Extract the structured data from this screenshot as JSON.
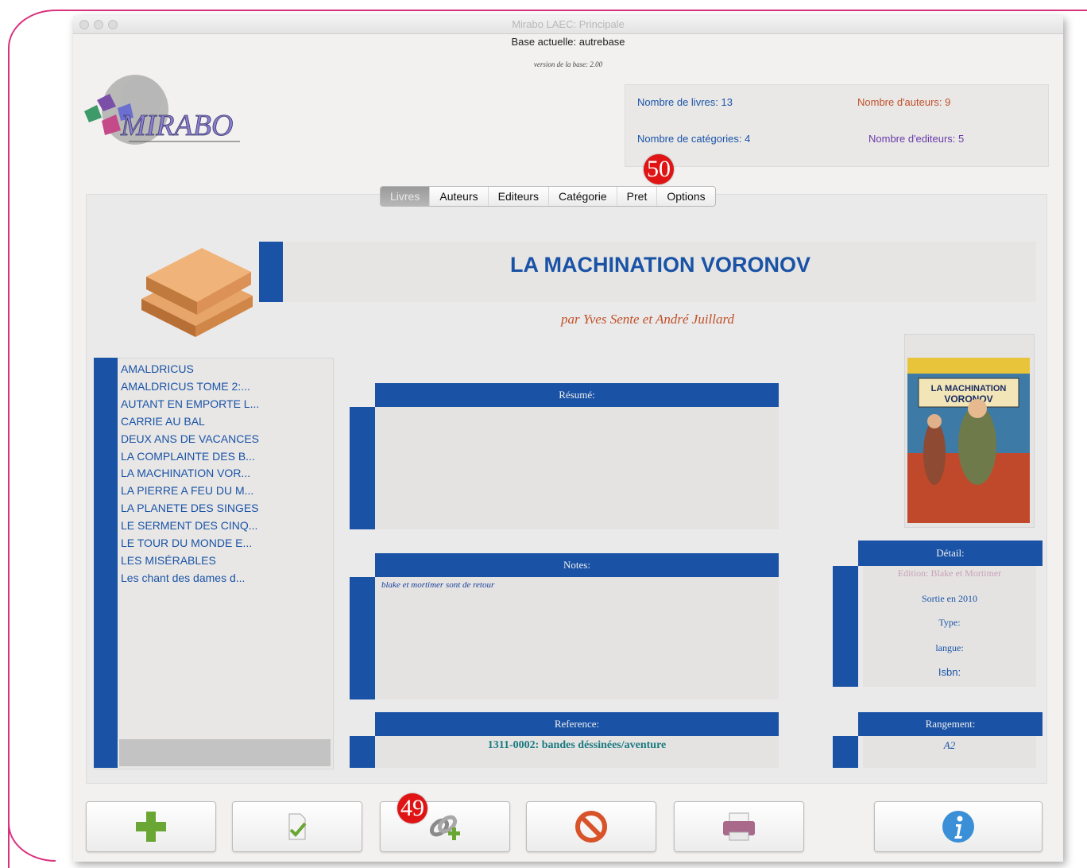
{
  "window": {
    "title": "Mirabo LAEC:  Principale",
    "base_label": "Base actuelle: autrebase",
    "version_label": "version de la base: 2.00"
  },
  "stats": {
    "livres": "Nombre de livres: 13",
    "auteurs": "Nombre d'auteurs: 9",
    "categories": "Nombre de catégories: 4",
    "editeurs": "Nombre d'editeurs: 5"
  },
  "tabs": [
    "Livres",
    "Auteurs",
    "Editeurs",
    "Catégorie",
    "Pret",
    "Options"
  ],
  "badges": {
    "tabs_badge": "50",
    "toolbar_badge": "49"
  },
  "book": {
    "title": "LA MACHINATION  VORONOV",
    "author": "par Yves Sente et André Juillard",
    "cover_line1": "LA MACHINATION",
    "cover_line2": "VORONOV"
  },
  "book_list": [
    "AMALDRICUS",
    "AMALDRICUS TOME 2:...",
    "AUTANT EN EMPORTE L...",
    "CARRIE AU BAL",
    "DEUX ANS DE VACANCES",
    "LA COMPLAINTE DES B...",
    "LA MACHINATION  VOR...",
    "LA PIERRE  A FEU DU M...",
    "LA PLANETE DES SINGES",
    "LE SERMENT DES CINQ...",
    "LE TOUR DU MONDE E...",
    "LES MISÉRABLES",
    "Les chant des dames d..."
  ],
  "sections": {
    "resume_label": "Résumé:",
    "notes_label": "Notes:",
    "notes_text": "blake et mortimer sont de retour",
    "reference_label": "Reference:",
    "reference_text": "1311-0002: bandes déssinées/aventure",
    "detail_label": "Détail:",
    "rangement_label": "Rangement:",
    "rangement_value": "A2"
  },
  "detail": {
    "edition": "Edition: Blake et Mortimer",
    "sortie": "Sortie en 2010",
    "type": "Type:",
    "langue": "langue:",
    "isbn": "Isbn:"
  },
  "toolbar": [
    "add-icon",
    "validate-icon",
    "link-add-icon",
    "delete-icon",
    "print-icon",
    "info-icon"
  ],
  "colors": {
    "accent_blue": "#1a53a6",
    "badge_red": "#e01414",
    "author_orange": "#c0502a"
  }
}
